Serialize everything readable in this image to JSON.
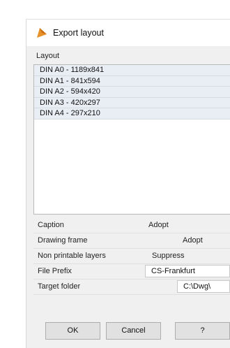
{
  "dialog": {
    "title": "Export layout",
    "title_icon": "app-triangle-icon",
    "accent_color": "#e8912a"
  },
  "layout": {
    "label": "Layout",
    "items": [
      "DIN A0 - 1189x841",
      "DIN A1 - 841x594",
      "DIN A2 - 594x420",
      "DIN A3 - 420x297",
      "DIN A4 - 297x210"
    ]
  },
  "properties": {
    "caption": {
      "label": "Caption",
      "value": "Adopt"
    },
    "drawing_frame": {
      "label": "Drawing frame",
      "value": "Adopt"
    },
    "non_printable": {
      "label": "Non printable layers",
      "value": "Suppress"
    },
    "file_prefix": {
      "label": "File Prefix",
      "value": "CS-Frankfurt"
    },
    "target_folder": {
      "label": "Target folder",
      "value": "C:\\Dwg\\"
    }
  },
  "buttons": {
    "ok": "OK",
    "cancel": "Cancel",
    "help": "?"
  }
}
